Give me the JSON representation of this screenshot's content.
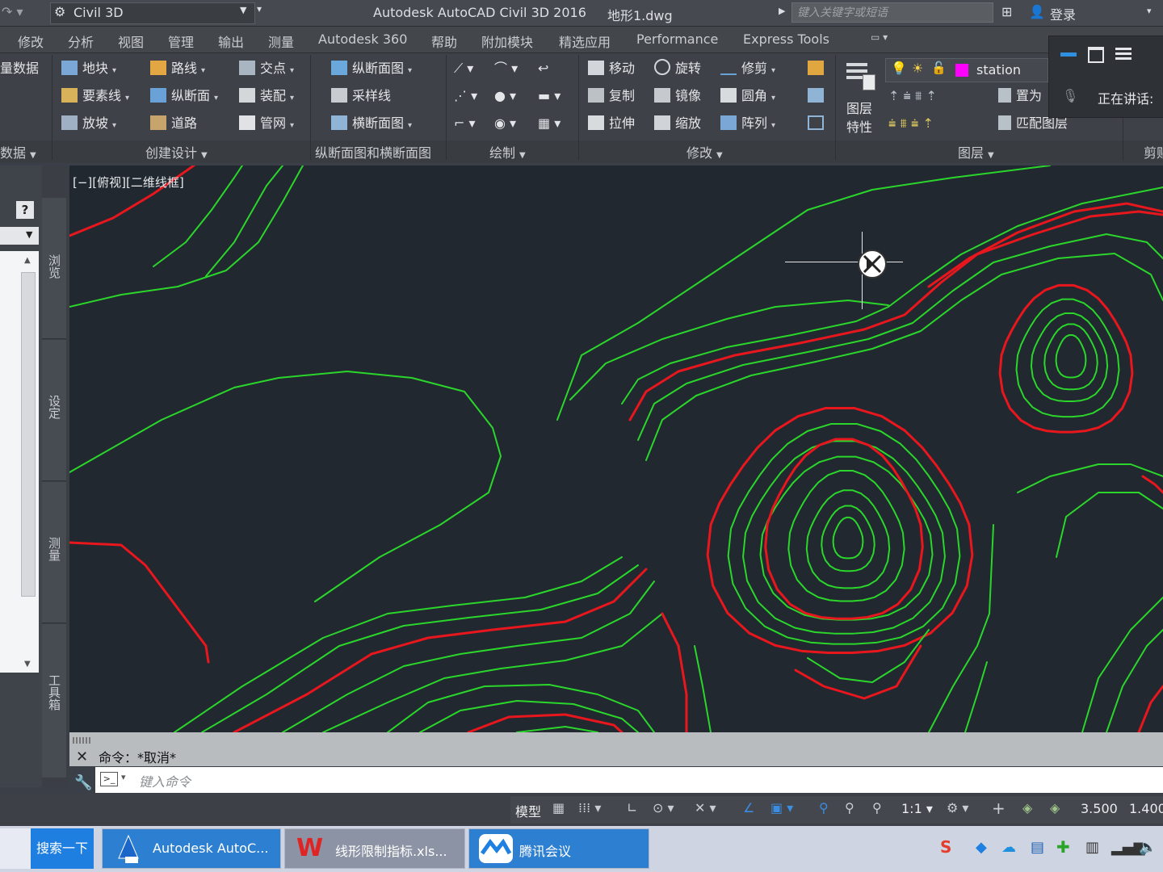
{
  "titlebar": {
    "workspace": "Civil 3D",
    "title": "Autodesk AutoCAD Civil 3D 2016",
    "filename": "地形1.dwg",
    "search_placeholder": "键入关键字或短语",
    "login": "登录"
  },
  "menu": [
    "修改",
    "分析",
    "视图",
    "管理",
    "输出",
    "测量",
    "Autodesk 360",
    "帮助",
    "附加模块",
    "精选应用",
    "Performance",
    "Express Tools"
  ],
  "ribbon": {
    "left_cut": {
      "item1": "量数据",
      "title": "数据"
    },
    "create_design": {
      "title": "创建设计",
      "col1": [
        "地块",
        "要素线",
        "放坡"
      ],
      "col2": [
        "路线",
        "纵断面",
        "道路"
      ],
      "col3": [
        "交点",
        "装配",
        "管网"
      ]
    },
    "profile_section": {
      "title": "纵断面图和横断面图",
      "items": [
        "纵断面图",
        "采样线",
        "横断面图"
      ]
    },
    "draw": {
      "title": "绘制"
    },
    "modify": {
      "title": "修改",
      "col1": [
        "移动",
        "复制",
        "拉伸"
      ],
      "col2": [
        "旋转",
        "镜像",
        "缩放"
      ],
      "col3": [
        "修剪",
        "圆角",
        "阵列"
      ]
    },
    "layers": {
      "title": "图层",
      "props_label_1": "图层",
      "props_label_2": "特性",
      "layer_name": "station",
      "layer_color": "#ff00ff",
      "set_current": "置为",
      "match": "匹配图层"
    },
    "clip_title": "剪贴",
    "speaking": "正在讲话:"
  },
  "palette": {
    "help": "?",
    "tabs": [
      "浏览",
      "设定",
      "测量",
      "工具箱"
    ]
  },
  "viewport": {
    "label": "[−][俯视][二维线框]"
  },
  "contours": {
    "green": "#2bd62b",
    "red": "#e8161d",
    "background": "#212830"
  },
  "command": {
    "history": "命令：*取消*",
    "placeholder": "键入命令"
  },
  "status": {
    "model": "模型",
    "scale": "1:1",
    "val1": "3.500",
    "val2": "1.400"
  },
  "taskbar": {
    "search": "搜索一下",
    "apps": [
      "Autodesk AutoC...",
      "线形限制指标.xls...",
      "腾讯会议"
    ]
  }
}
